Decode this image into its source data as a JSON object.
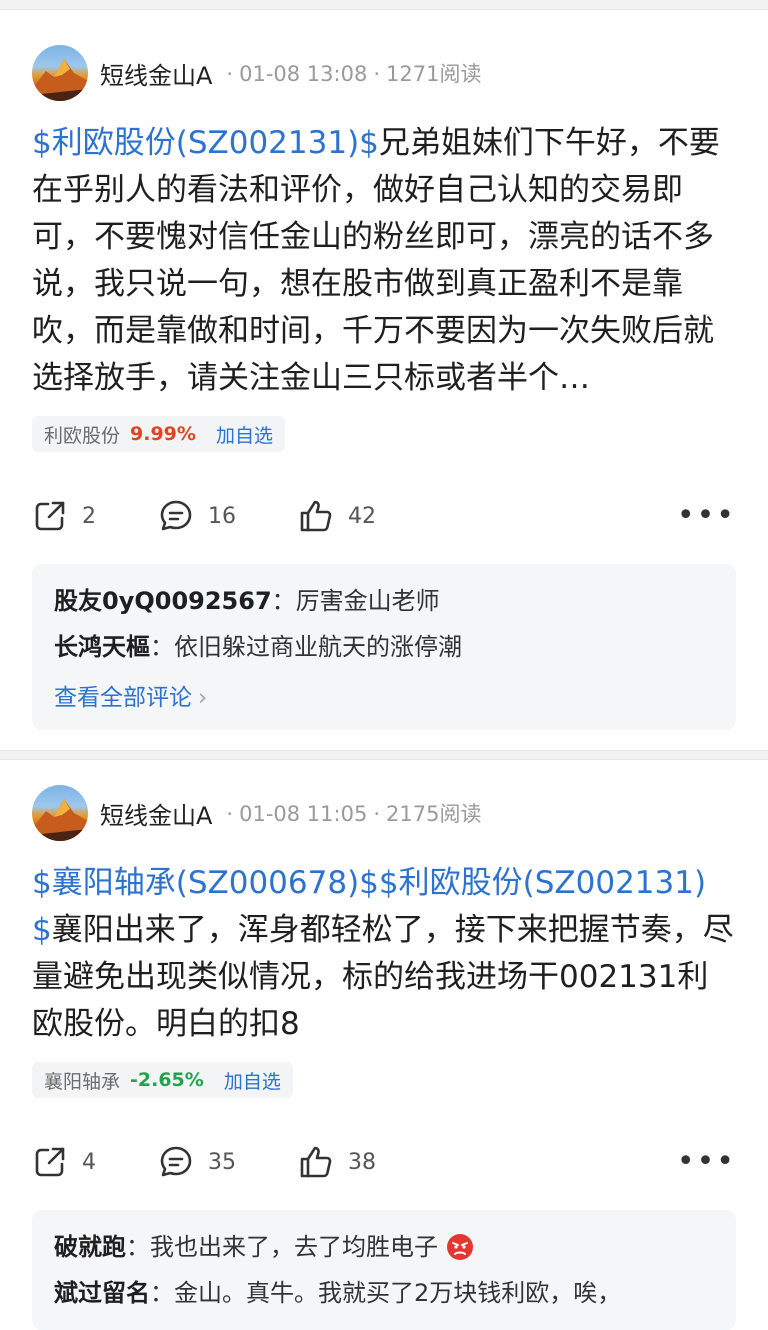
{
  "posts": [
    {
      "author": "短线金山A",
      "date": "01-08 13:08",
      "reads": "1271阅读",
      "stock_links": [
        "$利欧股份(SZ002131)$"
      ],
      "body_text": "兄弟姐妹们下午好，不要在乎别人的看法和评价，做好自己认知的交易即可，不要愧对信任金山的粉丝即可，漂亮的话不多说，我只说一句，想在股市做到真正盈利不是靠吹，而是靠做和时间，千万不要因为一次失败后就选择放手，请关注金山三只标或者半个…",
      "tag": {
        "name": "利欧股份",
        "change": "9.99%",
        "add_label": "加自选",
        "direction": "up"
      },
      "shares": "2",
      "comments_count": "16",
      "likes": "42",
      "comments": [
        {
          "user": "股友0yQ0092567",
          "text": "厉害金山老师"
        },
        {
          "user": "长鸿天樞",
          "text": "依旧躲过商业航天的涨停潮"
        }
      ],
      "view_all": "查看全部评论"
    },
    {
      "author": "短线金山A",
      "date": "01-08 11:05",
      "reads": "2175阅读",
      "stock_links": [
        "$襄阳轴承(SZ000678)$",
        "$利欧股份(SZ002131)$"
      ],
      "body_text": "襄阳出来了，浑身都轻松了，接下来把握节奏，尽量避免出现类似情况，标的给我进场干002131利欧股份。明白的扣8",
      "tag": {
        "name": "襄阳轴承",
        "change": "-2.65%",
        "add_label": "加自选",
        "direction": "down"
      },
      "shares": "4",
      "comments_count": "35",
      "likes": "38",
      "comments": [
        {
          "user": "破就跑",
          "text": "我也出来了，去了均胜电子"
        },
        {
          "user": "斌过留名",
          "text": "金山。真牛。我就买了2万块钱利欧，唉，"
        }
      ]
    }
  ],
  "colors": {
    "link": "#2c72d0",
    "up": "#e0451f",
    "down": "#22a34d"
  },
  "icons": [
    "share-icon",
    "comment-icon",
    "like-icon",
    "more-icon",
    "angry-emoji-icon"
  ]
}
